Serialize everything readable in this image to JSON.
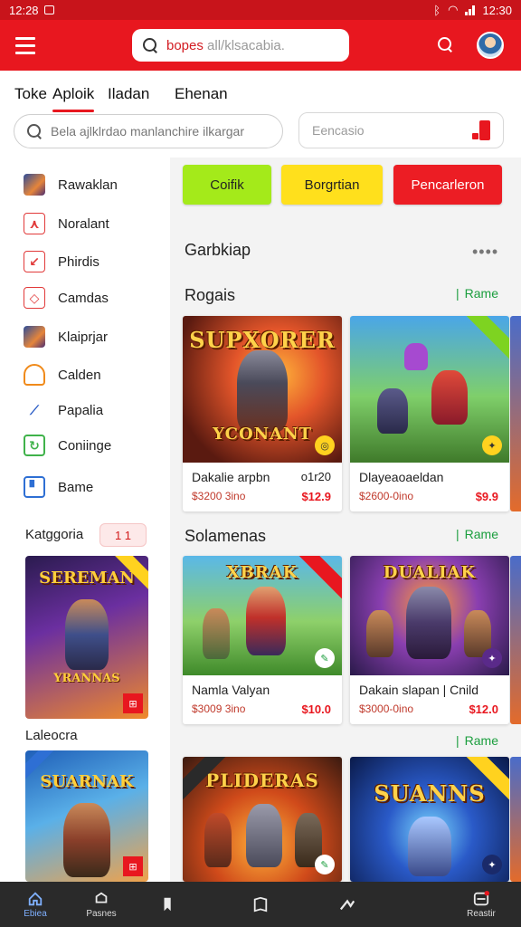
{
  "status_bar": {
    "time_left": "12:28",
    "time_right": "12:30"
  },
  "header": {
    "search_text_red": "bopes",
    "search_text_gray": " all/klsacabia.",
    "colors": {
      "brand": "#e8171f",
      "status": "#c8141b"
    }
  },
  "tabs": [
    {
      "label": "Toke"
    },
    {
      "label": "Aploik"
    },
    {
      "label": "Iladan"
    },
    {
      "label": "Ehenan"
    }
  ],
  "search_bar": {
    "placeholder": "Bela ajlklrdao manlanchire ilkargar"
  },
  "search_bar_right": {
    "placeholder": "Eencasio"
  },
  "sidebar": {
    "items": [
      {
        "label": "Rawaklan",
        "icon": "game-icon"
      },
      {
        "label": "Noralant",
        "icon": "tag-icon"
      },
      {
        "label": "Phirdis",
        "icon": "arrow-icon"
      },
      {
        "label": "Camdas",
        "icon": "diamond-icon"
      },
      {
        "label": "Klaiprjar",
        "icon": "game-icon"
      },
      {
        "label": "Calden",
        "icon": "house-icon"
      },
      {
        "label": "Papalia",
        "icon": "pen-icon"
      },
      {
        "label": "Coniinge",
        "icon": "refresh-icon"
      },
      {
        "label": "Bame",
        "icon": "grid-icon"
      }
    ],
    "category_label": "Katggoria",
    "category_chip": "1 1",
    "category_label_2": "Laleocra",
    "card_1_title": "SEREMAN",
    "card_1_sub": "YRANNAS",
    "card_2_title": "SUARNAK"
  },
  "main": {
    "pills": [
      {
        "label": "Coifik",
        "color": "#a4ea1a"
      },
      {
        "label": "Borgrtian",
        "color": "#ffe01c"
      },
      {
        "label": "Pencarleron",
        "color": "#ec1d24"
      }
    ],
    "section_header": "Garbkiap",
    "sections": [
      {
        "title": "Rogais",
        "see_all": "Rame",
        "cards": [
          {
            "name": "Dakalie arpbn",
            "extra": "o1r20",
            "sub": "$3200 3ino",
            "price": "$12.9",
            "art_title": "SUPXORER",
            "art_sub": "YCONANT"
          },
          {
            "name": "Dlayeaoaeldan",
            "extra": "",
            "sub": "$2600-0ino",
            "price": "$9.9",
            "art_title": "",
            "art_sub": ""
          }
        ]
      },
      {
        "title": "Solamenas",
        "see_all": "Rame",
        "cards": [
          {
            "name": "Namla Valyan",
            "extra": "",
            "sub": "$3009 3ino",
            "price": "$10.0",
            "art_title": "XBRAK",
            "art_sub": ""
          },
          {
            "name": "Dakain slapan | Cnild",
            "extra": "",
            "sub": "$3000-0ino",
            "price": "$12.0",
            "art_title": "DUALIAK",
            "art_sub": ""
          }
        ]
      },
      {
        "title": "",
        "see_all": "Rame",
        "cards": [
          {
            "art_title": "PLIDERAS"
          },
          {
            "art_title": "SUANNS"
          }
        ]
      }
    ]
  },
  "bottom_nav": [
    {
      "label": "Ebiea",
      "icon": "home-icon"
    },
    {
      "label": "Pasnes",
      "icon": "chat-icon"
    },
    {
      "label": "",
      "icon": "bookmark-icon"
    },
    {
      "label": "",
      "icon": "book-icon"
    },
    {
      "label": "",
      "icon": "share-icon"
    },
    {
      "label": "Reastir",
      "icon": "profile-icon"
    }
  ]
}
